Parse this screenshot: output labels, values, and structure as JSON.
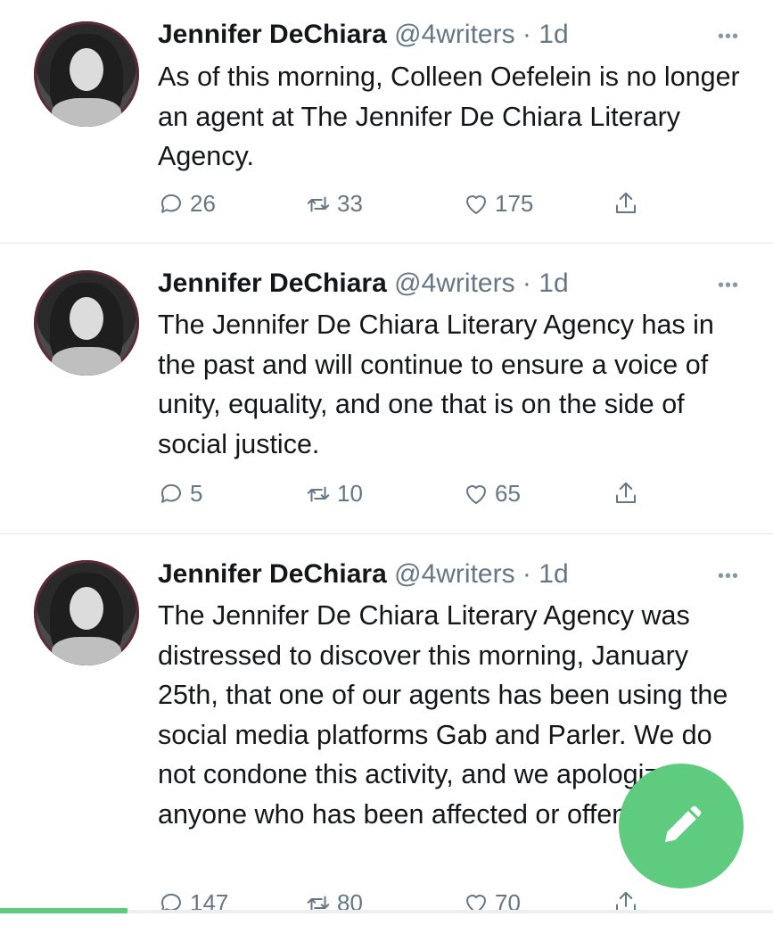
{
  "tweets": [
    {
      "name": "Jennifer DeChiara",
      "handle": "@4writers",
      "sep": "·",
      "time": "1d",
      "more": "•••",
      "text": "As of this morning, Colleen Oefelein is no longer an agent at The Jennifer De Chiara Literary Agency.",
      "replies": "26",
      "retweets": "33",
      "likes": "175"
    },
    {
      "name": "Jennifer DeChiara",
      "handle": "@4writers",
      "sep": "·",
      "time": "1d",
      "more": "•••",
      "text": "The Jennifer De Chiara Literary Agency has in the past and will continue to ensure a voice of unity, equality, and one that is on the side of social justice.",
      "replies": "5",
      "retweets": "10",
      "likes": "65"
    },
    {
      "name": "Jennifer DeChiara",
      "handle": "@4writers",
      "sep": "·",
      "time": "1d",
      "more": "•••",
      "text": "The Jennifer De Chiara Literary Agency was distressed to discover this morning, January 25th, that one of our agents has been using the social media platforms Gab and Parler. We do not condone this activity, and we apologize to anyone who has been affected or offended by",
      "replies": "147",
      "retweets": "80",
      "likes": "70"
    }
  ],
  "icons": {
    "reply": "reply-icon",
    "retweet": "retweet-icon",
    "like": "heart-icon",
    "share": "share-icon",
    "compose": "compose-pencil-icon"
  },
  "colors": {
    "accent_green": "#5ecb7f",
    "meta_gray": "#657786",
    "divider": "#e1e8ed"
  }
}
